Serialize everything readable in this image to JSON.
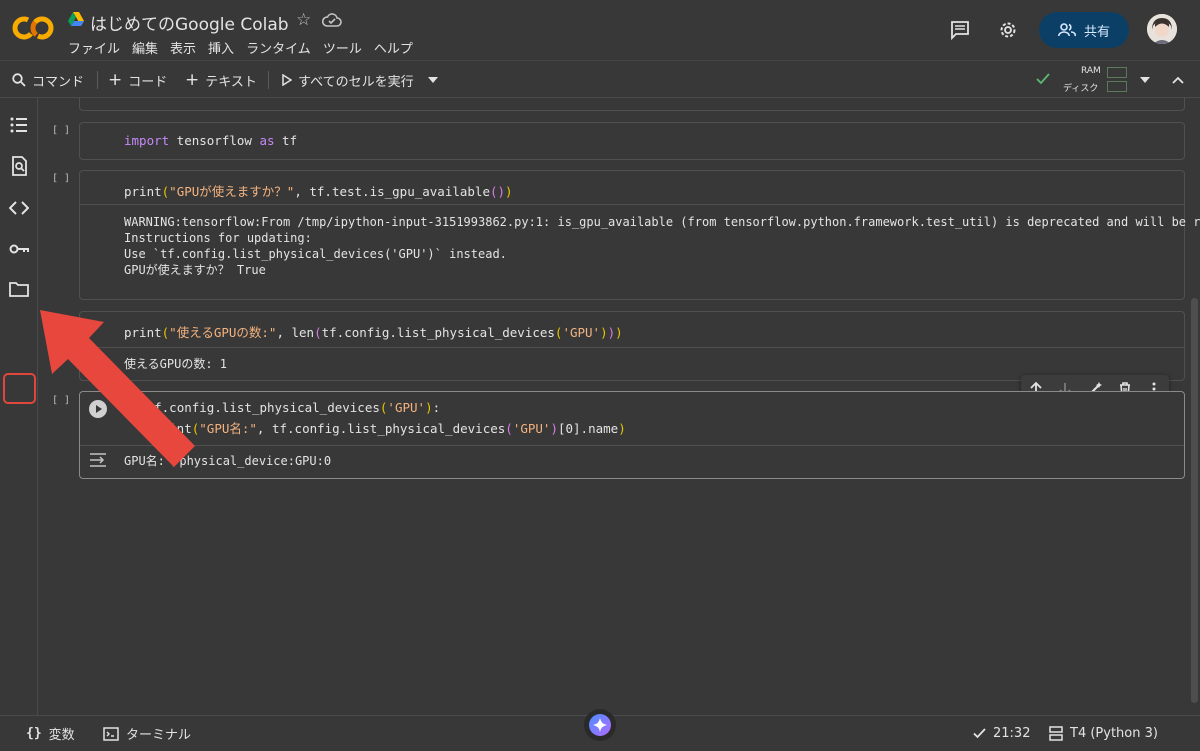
{
  "header": {
    "title": "はじめてのGoogle Colab",
    "logo_text": "CO",
    "menu": [
      "ファイル",
      "編集",
      "表示",
      "挿入",
      "ランタイム",
      "ツール",
      "ヘルプ"
    ],
    "share_label": "共有"
  },
  "toolbar": {
    "command_label": "コマンド",
    "code_label": "コード",
    "text_label": "テキスト",
    "run_all_label": "すべてのセルを実行",
    "ram_label": "RAM",
    "disk_label": "ディスク"
  },
  "cells": [
    {
      "bracket": "[ ]",
      "code": "import tensorflow as tf"
    },
    {
      "bracket": "[ ]",
      "code": "print(\"GPUが使えますか？\", tf.test.is_gpu_available())",
      "output": "WARNING:tensorflow:From /tmp/ipython-input-3151993862.py:1: is_gpu_available (from tensorflow.python.framework.test_util) is deprecated and will be removed in a f\nInstructions for updating:\nUse `tf.config.list_physical_devices('GPU')` instead.\nGPUが使えますか？ True"
    },
    {
      "code": "print(\"使えるGPUの数:\", len(tf.config.list_physical_devices('GPU')))",
      "output": "使えるGPUの数: 1"
    },
    {
      "bracket": "[ ]",
      "code_line1": "if tf.config.list_physical_devices('GPU'):",
      "code_line2": "    print(\"GPU名:\", tf.config.list_physical_devices('GPU')[0].name)",
      "output": "GPU名: /physical_device:GPU:0"
    }
  ],
  "statusbar": {
    "variables_label": "変数",
    "terminal_label": "ターミナル",
    "time": "21:32",
    "runtime": "T4 (Python 3)"
  },
  "colors": {
    "background": "#383838",
    "accent_share": "#0b3f66",
    "highlight_red": "#e0473c",
    "logo_orange": "#f9ab00"
  }
}
